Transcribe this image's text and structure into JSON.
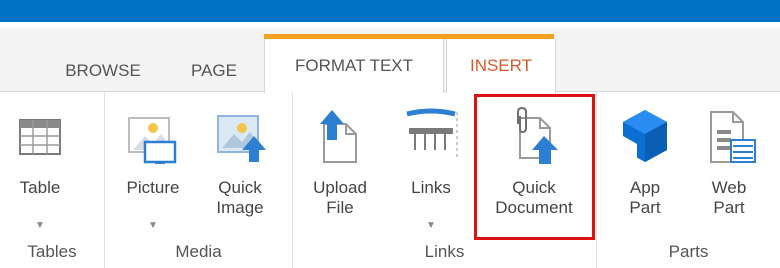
{
  "tabs": [
    {
      "label": "BROWSE"
    },
    {
      "label": "PAGE"
    },
    {
      "label": "FORMAT TEXT"
    },
    {
      "label": "INSERT"
    }
  ],
  "commands": {
    "table": {
      "line1": "Table",
      "arrow": "▼"
    },
    "picture": {
      "line1": "Picture",
      "arrow": "▼"
    },
    "quick_image": {
      "line1": "Quick",
      "line2": "Image"
    },
    "upload_file": {
      "line1": "Upload",
      "line2": "File"
    },
    "links": {
      "line1": "Links",
      "arrow": "▼"
    },
    "quick_document": {
      "line1": "Quick",
      "line2": "Document"
    },
    "app_part": {
      "line1": "App",
      "line2": "Part"
    },
    "web_part": {
      "line1": "Web",
      "line2": "Part"
    }
  },
  "groups": {
    "tables": "Tables",
    "media": "Media",
    "links": "Links",
    "parts": "Parts"
  },
  "colors": {
    "suite_bar": "#0072c6",
    "context_tab_band": "#f4a11d",
    "active_tab_text": "#d45a2a",
    "highlight_border": "#dd1111"
  },
  "icons": [
    "table-icon",
    "picture-icon",
    "quick-image-icon",
    "upload-file-icon",
    "links-icon",
    "quick-document-icon",
    "app-part-icon",
    "web-part-icon"
  ]
}
